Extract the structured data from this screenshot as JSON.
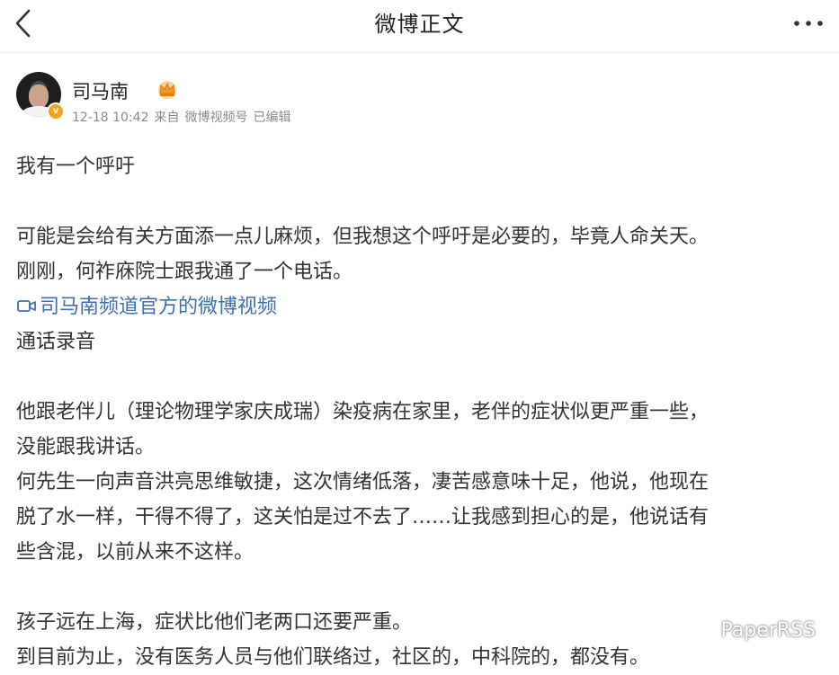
{
  "header": {
    "title": "微博正文"
  },
  "author": {
    "name": "司马南",
    "verify_mark": "v",
    "time": "12-18 10:42",
    "source_prefix": "来自",
    "source": "微博视频号",
    "edited": "已编辑"
  },
  "post": {
    "line1": "我有一个呼吁",
    "line2": "可能是会给有关方面添一点儿麻烦，但我想这个呼吁是必要的，毕竟人命关天。",
    "line3": "刚刚，何祚庥院士跟我通了一个电话。",
    "video_link": "司马南频道官方的微博视频",
    "line4": "通话录音",
    "line5": "他跟老伴儿（理论物理学家庆成瑞）染疫病在家里，老伴的症状似更严重一些，",
    "line6": "没能跟我讲话。",
    "line7": "何先生一向声音洪亮思维敏捷，这次情绪低落，凄苦感意味十足，他说，他现在",
    "line8": "脱了水一样，干得不得了，这关怕是过不去了……让我感到担心的是，他说话有",
    "line9": "些含混，以前从来不这样。",
    "line10": "孩子远在上海，症状比他们老两口还要严重。",
    "line11": "到目前为止，没有医务人员与他们联络过，社区的，中科院的，都没有。"
  },
  "watermark": {
    "text": "PaperRSS"
  },
  "colors": {
    "link": "#3d6fb2",
    "meta": "#8a8a8a",
    "badge": "#f7a21b"
  }
}
